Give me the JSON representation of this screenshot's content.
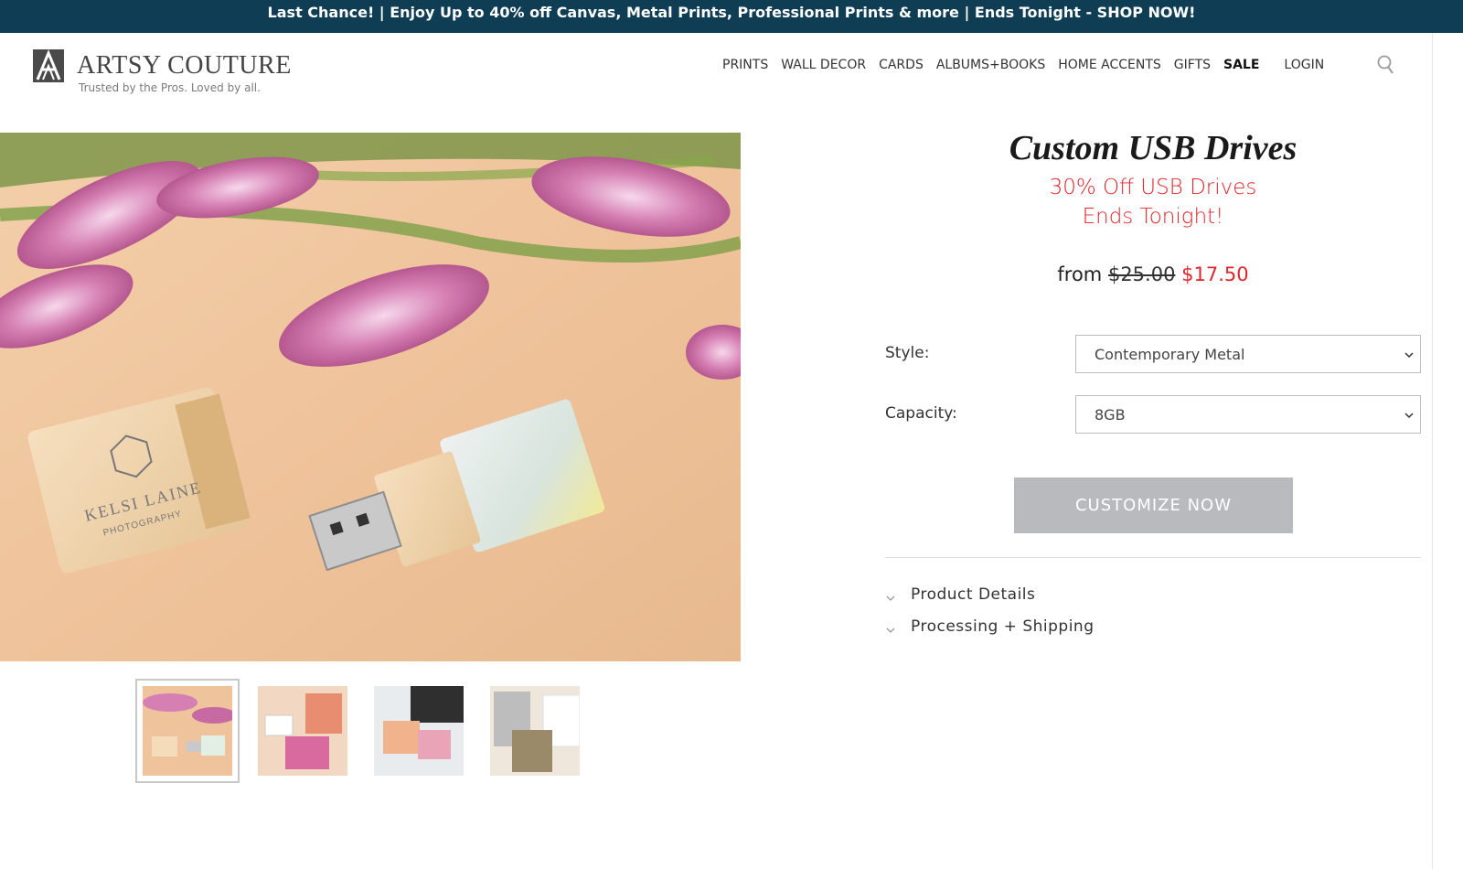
{
  "promo_bar": {
    "text": "Last Chance! | Enjoy Up to 40% off Canvas, Metal Prints, Professional Prints & more | Ends Tonight - SHOP NOW!"
  },
  "header": {
    "brand": "ARTSY COUTURE",
    "tagline": "Trusted by the Pros. Loved by all.",
    "nav": [
      "PRINTS",
      "WALL DECOR",
      "CARDS",
      "ALBUMS+BOOKS",
      "HOME ACCENTS",
      "GIFTS",
      "SALE"
    ],
    "login": "LOGIN",
    "search_icon": "search-icon"
  },
  "product": {
    "title": "Custom USB Drives",
    "promo_line_1": "30% Off USB Drives",
    "promo_line_2": "Ends Tonight!",
    "price_prefix": "from",
    "price_original": "$25.00",
    "price_sale": "$17.50",
    "style_label": "Style:",
    "style_value": "Contemporary Metal",
    "capacity_label": "Capacity:",
    "capacity_value": "8GB",
    "cta_label": "CUSTOMIZE NOW",
    "accordion": [
      "Product Details",
      "Processing + Shipping"
    ]
  },
  "gallery": {
    "selected_index": 0,
    "thumbnail_count": 4
  },
  "colors": {
    "promo_bg": "#0f3d54",
    "sale_red": "#e0262b",
    "cta_gray": "#b9babe"
  }
}
